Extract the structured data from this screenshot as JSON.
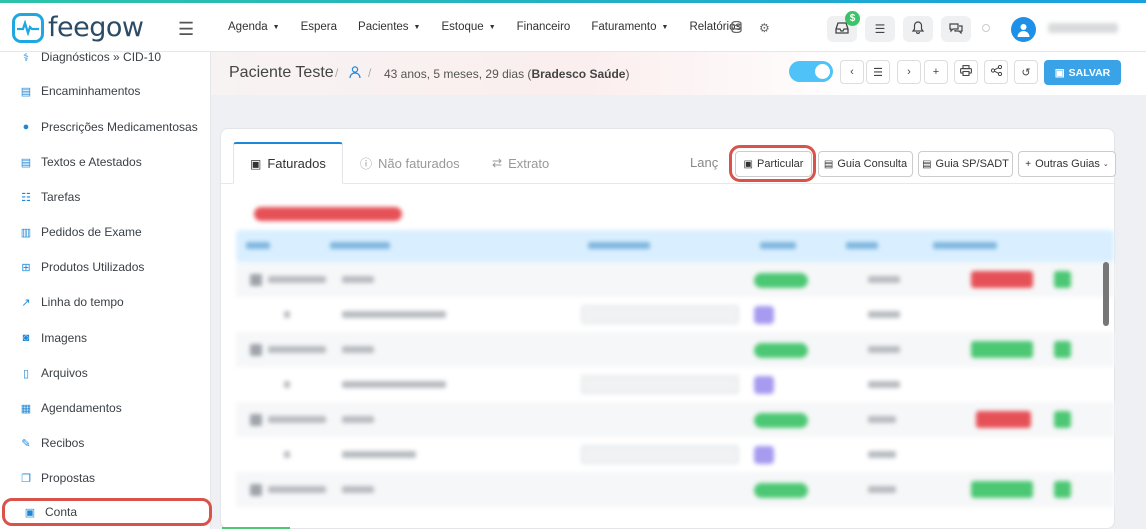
{
  "brand": {
    "name": "feegow",
    "accent": "#1ea7e1"
  },
  "nav": [
    {
      "label": "Agenda",
      "caret": true
    },
    {
      "label": "Espera",
      "caret": false
    },
    {
      "label": "Pacientes",
      "caret": true
    },
    {
      "label": "Estoque",
      "caret": true
    },
    {
      "label": "Financeiro",
      "caret": false
    },
    {
      "label": "Faturamento",
      "caret": true
    },
    {
      "label": "Relatórios",
      "caret": false
    }
  ],
  "header": {
    "money_badge": "$"
  },
  "sidebar": {
    "items": [
      {
        "label": "Diagnósticos » CID-10",
        "icon": "stethoscope-icon"
      },
      {
        "label": "Encaminhamentos",
        "icon": "document-icon"
      },
      {
        "label": "Prescrições Medicamentosas",
        "icon": "pills-icon"
      },
      {
        "label": "Textos e Atestados",
        "icon": "document-edit-icon"
      },
      {
        "label": "Tarefas",
        "icon": "checklist-icon"
      },
      {
        "label": "Pedidos de Exame",
        "icon": "clipboard-icon"
      },
      {
        "label": "Produtos Utilizados",
        "icon": "box-plus-icon"
      },
      {
        "label": "Linha do tempo",
        "icon": "chart-line-icon"
      },
      {
        "label": "Imagens",
        "icon": "camera-icon"
      },
      {
        "label": "Arquivos",
        "icon": "file-icon"
      },
      {
        "label": "Agendamentos",
        "icon": "calendar-icon"
      },
      {
        "label": "Recibos",
        "icon": "edit-icon"
      },
      {
        "label": "Propostas",
        "icon": "copy-icon"
      },
      {
        "label": "Conta",
        "icon": "money-icon"
      }
    ]
  },
  "patient": {
    "name": "Paciente Teste",
    "age": "43 anos, 5 meses, 29 dias",
    "insurance": "Bradesco Saúde",
    "save_label": "SALVAR"
  },
  "account": {
    "tabs": [
      {
        "label": "Faturados",
        "icon": "money-icon",
        "active": true
      },
      {
        "label": "Não faturados",
        "icon": "info-circle-icon",
        "active": false
      },
      {
        "label": "Extrato",
        "icon": "exchange-icon",
        "active": false
      }
    ],
    "lanc_label": "Lanç",
    "buttons": [
      {
        "label": "Particular",
        "icon": "money-icon"
      },
      {
        "label": "Guia Consulta",
        "icon": "card-icon"
      },
      {
        "label": "Guia SP/SADT",
        "icon": "card-icon"
      },
      {
        "label": "Outras Guias",
        "icon": "plus-icon"
      }
    ]
  }
}
